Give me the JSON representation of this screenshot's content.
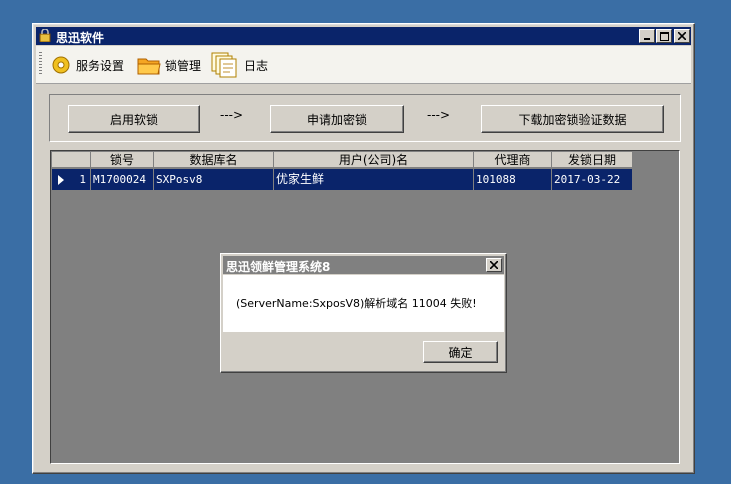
{
  "window": {
    "title": "思迅软件"
  },
  "toolbar": [
    {
      "label": "服务设置",
      "icon": "gear-icon"
    },
    {
      "label": "锁管理",
      "icon": "folder-icon"
    },
    {
      "label": "日志",
      "icon": "document-icon"
    }
  ],
  "steps": {
    "step1": "启用软锁",
    "arrow1": "--->",
    "step2": "申请加密锁",
    "arrow2": "--->",
    "step3": "下载加密锁验证数据"
  },
  "grid": {
    "columns": [
      "锁号",
      "数据库名",
      "用户(公司)名",
      "代理商",
      "发锁日期"
    ],
    "rows": [
      {
        "index": "1",
        "lock_no": "M1700024",
        "db_name": "SXPosv8",
        "company": "优家生鲜",
        "agent": "101088",
        "date": "2017-03-22"
      }
    ]
  },
  "dialog": {
    "title": "思迅领鲜管理系统8",
    "message": "(ServerName:SxposV8)解析域名 11004 失败!",
    "ok_label": "确定"
  },
  "colors": {
    "desktop": "#3a6ea5",
    "titlebar_active": "#0a246a",
    "titlebar_inactive": "#808080",
    "selection": "#0a246a"
  }
}
